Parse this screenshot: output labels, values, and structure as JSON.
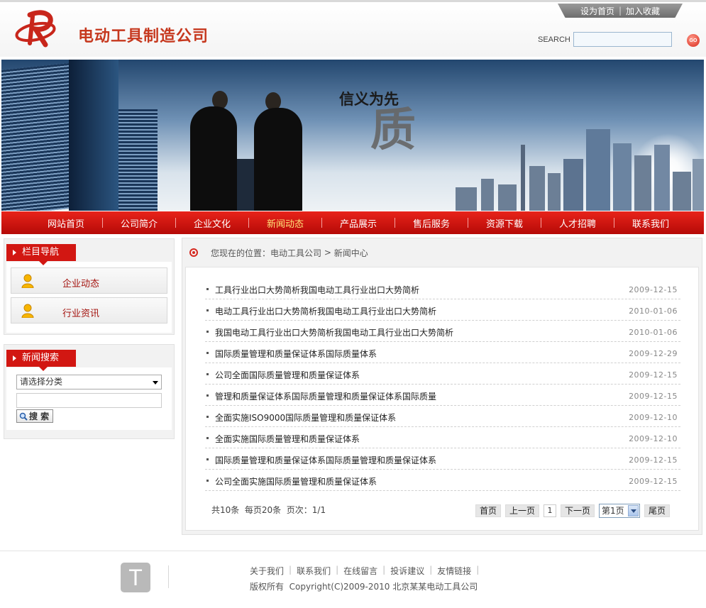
{
  "header": {
    "company_name": "电动工具制造公司",
    "top_links": [
      "设为首页",
      "加入收藏"
    ],
    "search_label": "SEARCH",
    "go_label": "GO"
  },
  "banner": {
    "slogan_small": "信义为先",
    "slogan_big": "质"
  },
  "nav": {
    "items": [
      "网站首页",
      "公司简介",
      "企业文化",
      "新闻动态",
      "产品展示",
      "售后服务",
      "资源下载",
      "人才招聘",
      "联系我们"
    ],
    "active_index": 3,
    "active_color": "#ffe27a"
  },
  "sidebar": {
    "nav_box": {
      "title": "栏目导航",
      "items": [
        "企业动态",
        "行业资讯"
      ]
    },
    "search_box": {
      "title": "新闻搜索",
      "select_value": "请选择分类",
      "keyword_value": "",
      "button_label": "搜 索"
    }
  },
  "breadcrumb": {
    "prefix": "您现在的位置：",
    "home": "电动工具公司",
    "sep": " > ",
    "current": "新闻中心"
  },
  "news": [
    {
      "title": "工具行业出口大势简析我国电动工具行业出口大势简析",
      "date": "2009-12-15"
    },
    {
      "title": "电动工具行业出口大势简析我国电动工具行业出口大势简析",
      "date": "2010-01-06"
    },
    {
      "title": "我国电动工具行业出口大势简析我国电动工具行业出口大势简析",
      "date": "2010-01-06"
    },
    {
      "title": "国际质量管理和质量保证体系国际质量体系",
      "date": "2009-12-29"
    },
    {
      "title": "公司全面国际质量管理和质量保证体系",
      "date": "2009-12-15"
    },
    {
      "title": "管理和质量保证体系国际质量管理和质量保证体系国际质量",
      "date": "2009-12-15"
    },
    {
      "title": "全面实施ISO9000国际质量管理和质量保证体系",
      "date": "2009-12-10"
    },
    {
      "title": "全面实施国际质量管理和质量保证体系",
      "date": "2009-12-10"
    },
    {
      "title": "国际质量管理和质量保证体系国际质量管理和质量保证体系",
      "date": "2009-12-15"
    },
    {
      "title": "公司全面实施国际质量管理和质量保证体系",
      "date": "2009-12-15"
    }
  ],
  "pager": {
    "info": "共10条  每页20条  页次：1/1",
    "first": "首页",
    "prev": "上一页",
    "current_page": "1",
    "next": "下一页",
    "select_value": "第1页",
    "last": "尾页"
  },
  "footer": {
    "logo_letter": "T",
    "links": [
      "关于我们",
      "联系我们",
      "在线留言",
      "投诉建议",
      "友情链接"
    ],
    "copyright": "版权所有  Copyright(C)2009-2010 北京某某电动工具公司"
  },
  "colors": {
    "brand_red": "#d21712",
    "nav_red": "#e8231a",
    "link_red": "#a3120d"
  }
}
